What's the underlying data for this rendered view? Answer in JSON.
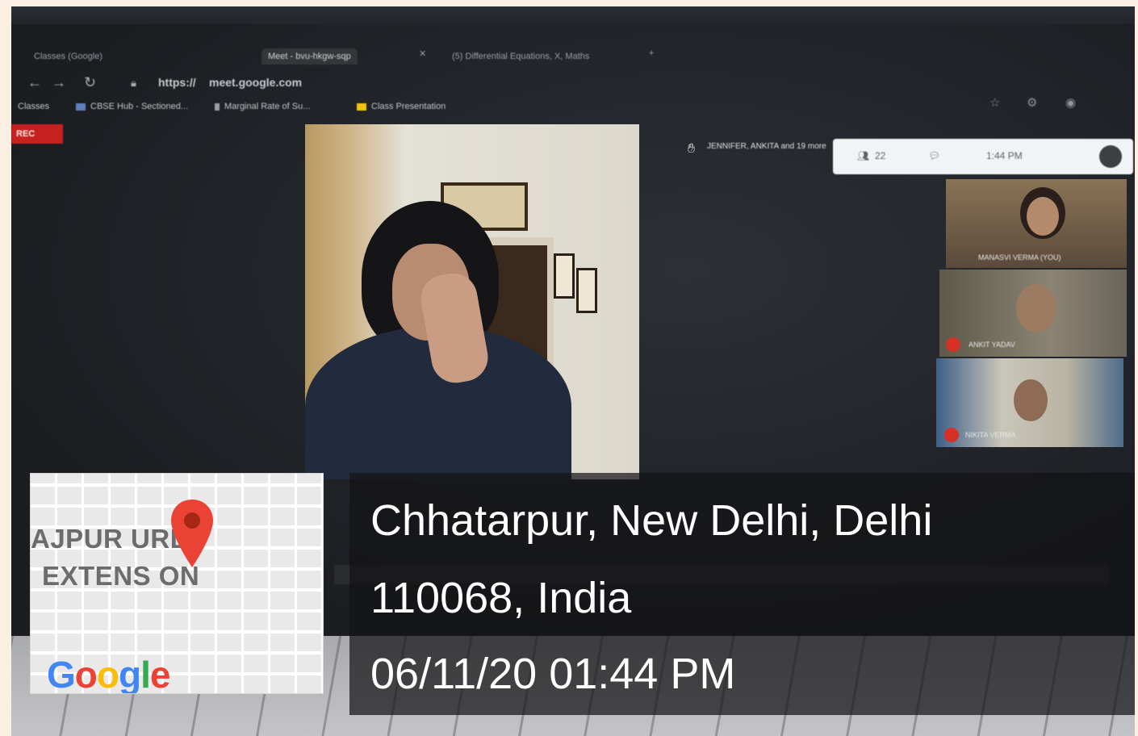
{
  "browser": {
    "tabs": [
      {
        "label": "Classes (Google)",
        "active": false
      },
      {
        "label": "Meet - bvu-hkgw-sqp",
        "active": true
      },
      {
        "label": "(5) Differential Equations, X, Maths",
        "active": false
      }
    ],
    "url_scheme": "https://",
    "url_host": "meet.google.com",
    "bookmarks": [
      "Classes",
      "CBSE Hub - Sectioned...",
      "Marginal Rate of Su...",
      "Class Presentation"
    ],
    "rec_label": "REC"
  },
  "meet": {
    "notification": "JENNIFER, ANKITA and 19 more",
    "topbar": {
      "participants": "22",
      "clock": "1:44 PM"
    },
    "participants": [
      {
        "name": "MANASVI VERMA (YOU)"
      },
      {
        "name": "ANKIT YADAV"
      },
      {
        "name": "NIKITA VERMA"
      }
    ]
  },
  "map": {
    "line1": "AJPUR  URD",
    "line2": "EXTENS  ON",
    "logo": "Google",
    "pin_color": "#ea4335",
    "logo_colors": [
      "#4285f4",
      "#ea4335",
      "#fbbc05",
      "#4285f4",
      "#34a853",
      "#ea4335"
    ]
  },
  "location": {
    "line1": "Chhatarpur, New Delhi, Delhi",
    "line2": "110068, India",
    "line3": "06/11/20 01:44 PM"
  }
}
